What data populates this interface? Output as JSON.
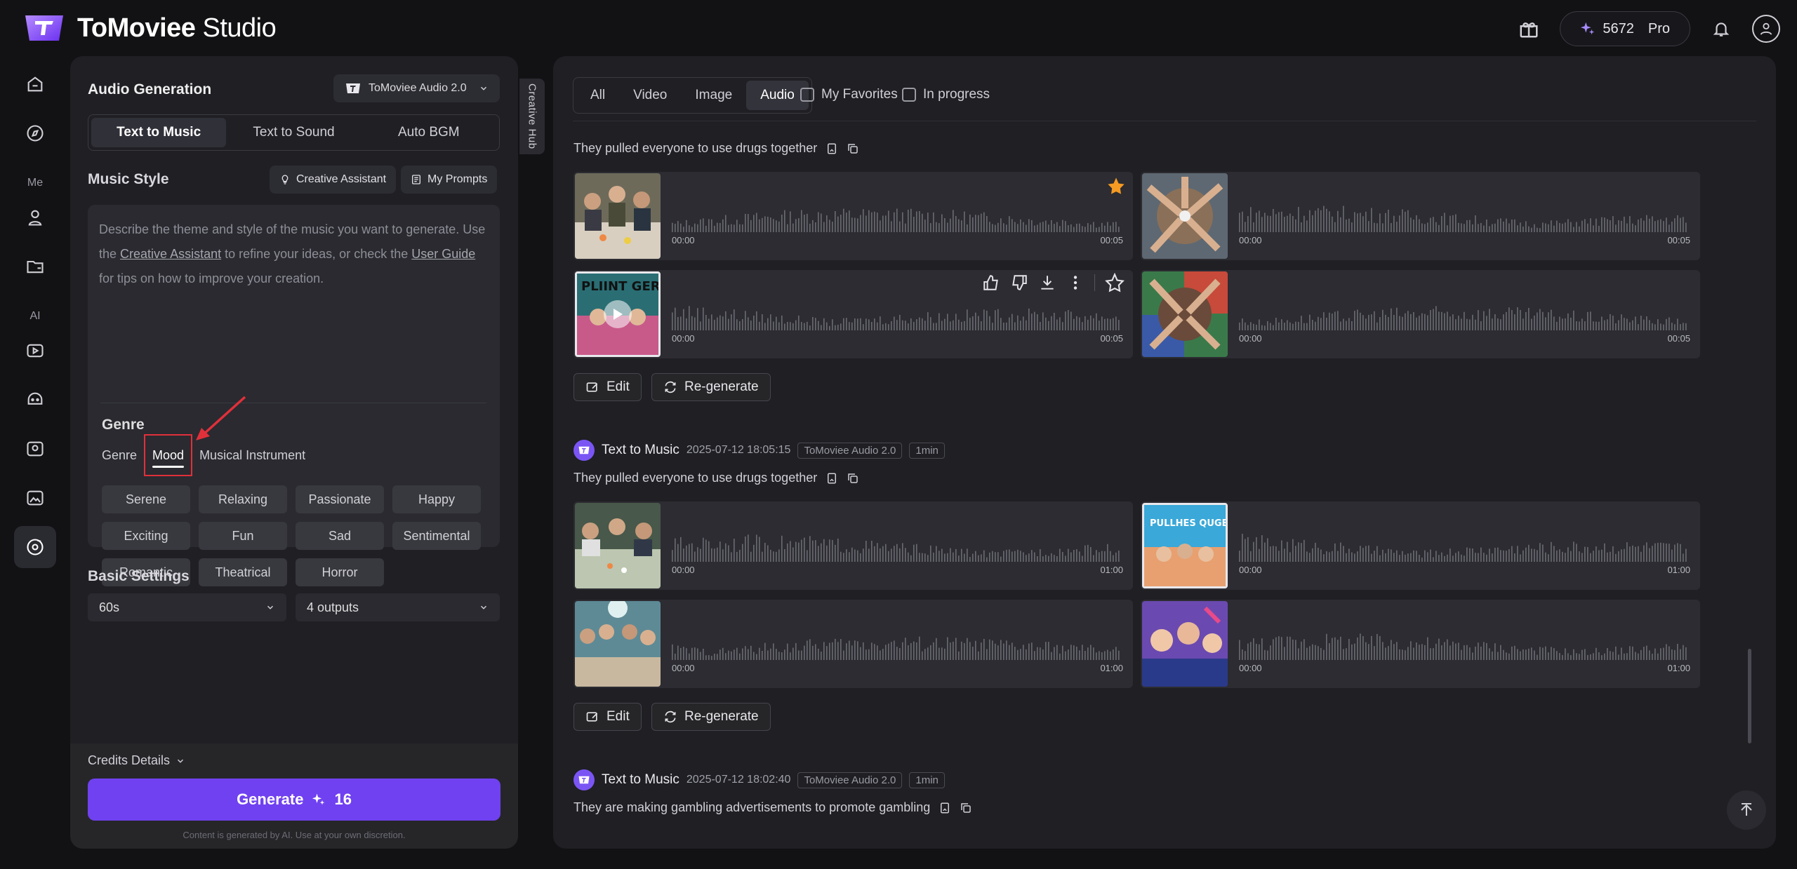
{
  "app": {
    "brand_bold": "ToMoviee",
    "brand_light": "Studio"
  },
  "topbar": {
    "credits": "5672",
    "plan": "Pro"
  },
  "rail": {
    "me_label": "Me",
    "ai_label": "AI"
  },
  "panel": {
    "title": "Audio Generation",
    "model": "ToMoviee Audio 2.0",
    "tabs": [
      "Text to Music",
      "Text to Sound",
      "Auto BGM"
    ],
    "music_style_title": "Music Style",
    "creative_assistant_label": "Creative Assistant",
    "my_prompts_label": "My Prompts",
    "prompt_part1": "Describe the theme and style of the music you want to generate. Use the ",
    "prompt_link1": "Creative Assistant",
    "prompt_part2": " to refine your ideas, or check the ",
    "prompt_link2": "User Guide",
    "prompt_part3": " for tips on how to improve your creation.",
    "genre_title": "Genre",
    "sub_tabs": [
      "Genre",
      "Mood",
      "Musical Instrument"
    ],
    "moods": [
      "Serene",
      "Relaxing",
      "Passionate",
      "Happy",
      "Exciting",
      "Fun",
      "Sad",
      "Sentimental",
      "Romantic",
      "Theatrical",
      "Horror"
    ],
    "basic_settings_title": "Basic Settings",
    "duration": "60s",
    "outputs": "4 outputs",
    "credits_details": "Credits Details",
    "generate_label": "Generate",
    "generate_cost": "16",
    "disclaimer": "Content is generated by AI. Use at your own discretion."
  },
  "hub_tab": "Creative Hub",
  "main": {
    "filter_tabs": [
      "All",
      "Video",
      "Image",
      "Audio"
    ],
    "active_filter": "Audio",
    "my_favorites": "My Favorites",
    "in_progress": "In progress",
    "edit_label": "Edit",
    "regenerate_label": "Re-generate",
    "group1": {
      "prompt": "They pulled everyone to use drugs together",
      "tracks": [
        {
          "start": "00:00",
          "end": "00:05"
        },
        {
          "start": "00:00",
          "end": "00:05"
        },
        {
          "start": "00:00",
          "end": "00:05"
        },
        {
          "start": "00:00",
          "end": "00:05"
        }
      ]
    },
    "group2": {
      "type": "Text to Music",
      "datetime": "2025-07-12 18:05:15",
      "model": "ToMoviee Audio 2.0",
      "duration": "1min",
      "prompt": "They pulled everyone to use drugs together",
      "cover_text": "PULLHES QUGES",
      "tracks": [
        {
          "start": "00:00",
          "end": "01:00"
        },
        {
          "start": "00:00",
          "end": "01:00"
        },
        {
          "start": "00:00",
          "end": "01:00"
        },
        {
          "start": "00:00",
          "end": "01:00"
        }
      ]
    },
    "group3": {
      "type": "Text to Music",
      "datetime": "2025-07-12 18:02:40",
      "model": "ToMoviee Audio 2.0",
      "duration": "1min",
      "prompt": "They are making gambling advertisements to promote gambling"
    },
    "poster_text": "PLIINT GERBE"
  }
}
